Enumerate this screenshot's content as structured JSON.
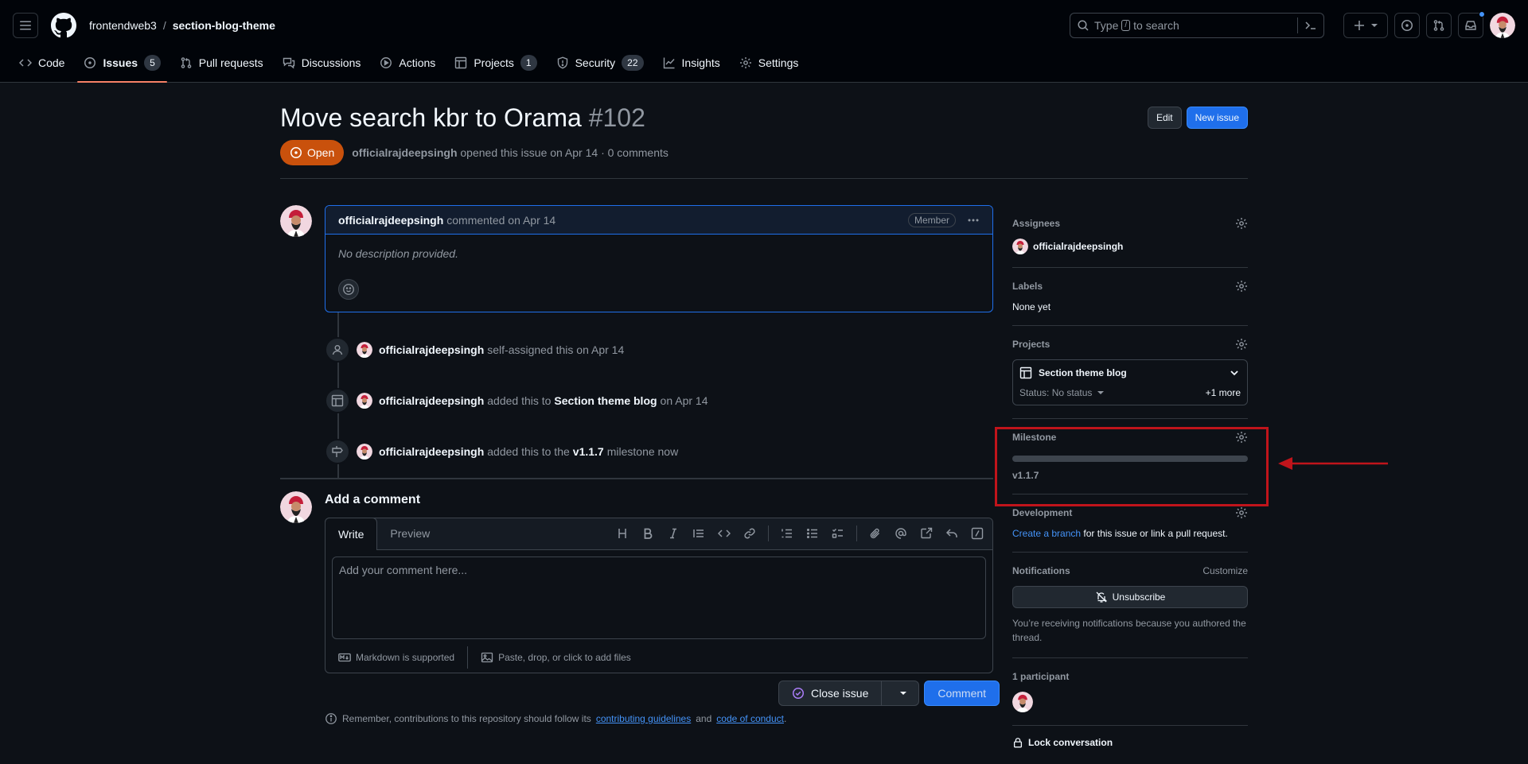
{
  "header": {
    "owner": "frontendweb3",
    "separator": "/",
    "repo": "section-blog-theme",
    "search_prefix": "Type",
    "search_key": "/",
    "search_suffix": "to search"
  },
  "tabs": [
    {
      "label": "Code",
      "icon": "code-icon"
    },
    {
      "label": "Issues",
      "count": "5",
      "icon": "issue-opened-icon",
      "active": true
    },
    {
      "label": "Pull requests",
      "icon": "git-pull-request-icon"
    },
    {
      "label": "Discussions",
      "icon": "comment-discussion-icon"
    },
    {
      "label": "Actions",
      "icon": "play-icon"
    },
    {
      "label": "Projects",
      "count": "1",
      "icon": "table-icon"
    },
    {
      "label": "Security",
      "count": "22",
      "icon": "shield-icon"
    },
    {
      "label": "Insights",
      "icon": "graph-icon"
    },
    {
      "label": "Settings",
      "icon": "gear-icon"
    }
  ],
  "issue": {
    "title": "Move search kbr to Orama",
    "number": "#102",
    "edit_label": "Edit",
    "new_issue_label": "New issue",
    "state": "Open",
    "author": "officialrajdeepsingh",
    "opened_text": "opened this issue on Apr 14 · 0 comments"
  },
  "comment": {
    "author": "officialrajdeepsingh",
    "action": "commented on Apr 14",
    "role": "Member",
    "body": "No description provided."
  },
  "events": [
    {
      "actor": "officialrajdeepsingh",
      "text_before": "self-assigned this on Apr 14",
      "bold": "",
      "text_after": "",
      "icon": "person-icon"
    },
    {
      "actor": "officialrajdeepsingh",
      "text_before": "added this to",
      "bold": "Section theme blog",
      "text_after": "on Apr 14",
      "icon": "table-icon"
    },
    {
      "actor": "officialrajdeepsingh",
      "text_before": "added this to the",
      "bold": "v1.1.7",
      "text_after": "milestone now",
      "icon": "milestone-icon"
    }
  ],
  "add_comment": {
    "title": "Add a comment",
    "tab_write": "Write",
    "tab_preview": "Preview",
    "placeholder": "Add your comment here...",
    "markdown_note": "Markdown is supported",
    "files_note": "Paste, drop, or click to add files",
    "close_issue": "Close issue",
    "comment_btn": "Comment",
    "footnote_before": "Remember, contributions to this repository should follow its",
    "guidelines_link": "contributing guidelines",
    "footnote_and": "and",
    "conduct_link": "code of conduct",
    "footnote_end": "."
  },
  "sidebar": {
    "assignees": {
      "heading": "Assignees",
      "value": "officialrajdeepsingh"
    },
    "labels": {
      "heading": "Labels",
      "value": "None yet"
    },
    "projects": {
      "heading": "Projects",
      "name": "Section theme blog",
      "status": "Status: No status",
      "more": "+1 more"
    },
    "milestone": {
      "heading": "Milestone",
      "name": "v1.1.7",
      "progress": 0
    },
    "development": {
      "heading": "Development",
      "link": "Create a branch",
      "text": "for this issue or link a pull request."
    },
    "notifications": {
      "heading": "Notifications",
      "customize": "Customize",
      "button": "Unsubscribe",
      "note": "You’re receiving notifications because you authored the thread."
    },
    "participants": {
      "heading": "1 participant"
    },
    "lock": {
      "label": "Lock conversation"
    }
  },
  "colors": {
    "accent_blue": "#1f6feb",
    "open_state": "#c9510c",
    "annotation_red": "#c0141b",
    "tab_underline": "#f78166"
  }
}
